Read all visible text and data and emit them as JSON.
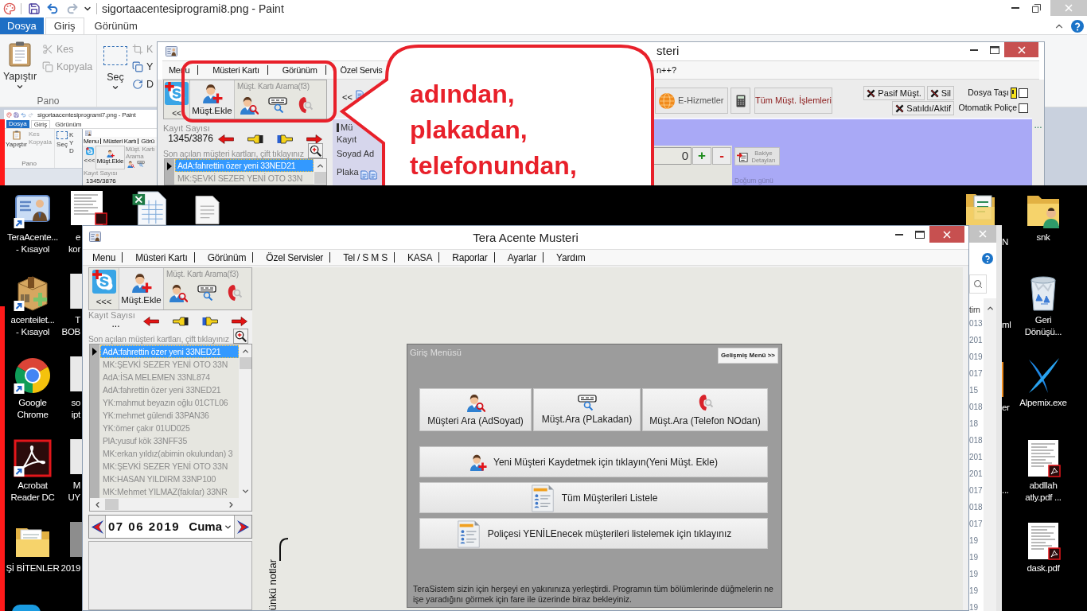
{
  "paint": {
    "title": "sigortaacentesiprogrami8.png - Paint",
    "tabs": [
      {
        "label": "Dosya",
        "kind": "file",
        "selected": false
      },
      {
        "label": "Giriş",
        "kind": "tab",
        "selected": true
      },
      {
        "label": "Görünüm",
        "kind": "tab",
        "selected": false
      }
    ],
    "clipboard": {
      "paste": "Yapıştır",
      "cut": {
        "label": "Kes",
        "disabled": true
      },
      "copy": {
        "label": "Kopyala",
        "disabled": true
      },
      "group": "Pano"
    },
    "image": {
      "select": "Seç",
      "tools": [
        {
          "label": "K",
          "disabled": true
        },
        {
          "label": "Y",
          "disabled": false
        },
        {
          "label": "D",
          "disabled": false
        }
      ]
    },
    "thumbnail": {
      "title": "sigortaacentesiprogrami7.png - Paint",
      "tabs": [
        {
          "label": "Dosya",
          "kind": "file",
          "selected": false
        },
        {
          "label": "Giriş",
          "kind": "tab",
          "selected": true
        },
        {
          "label": "Görünüm",
          "kind": "tab",
          "selected": false
        }
      ],
      "paste": "Yapıştır",
      "cut": "Kes",
      "copy": "Kopyala",
      "group": "Pano",
      "select": "Seç",
      "tools": [
        "K",
        "Y",
        "D"
      ],
      "window": {
        "menu": [
          "Menu",
          "Müsteri Kartı",
          "Görü"
        ],
        "back": "<<<",
        "add_button": "Müşt.Ekle",
        "search_label": "Müşt. Kartı Arama",
        "count_label": "Kayıt Sayısı",
        "count": "1345/3876"
      }
    }
  },
  "front_window": {
    "title": "steri",
    "menu": [
      "Menu",
      "Müsteri Kartı",
      "Görünüm",
      "Özel Servis"
    ],
    "menu_tail": "n++?",
    "back": "<<",
    "add_button": "Müşt.Ekle",
    "search_label": "Müşt. Kartı Arama(f3)",
    "count_label": "Kayıt Sayısı",
    "count": "1345/3876",
    "recent_label": "Son açılan müşteri kartları, çift tıklayınız",
    "recent": [
      {
        "text": "AdA:fahrettin özer yeni 33NED21",
        "selected": true
      },
      {
        "text": "MK:ŞEVKİ SEZER YENİ OTO 33N",
        "selected": false
      }
    ],
    "card_back": "<<",
    "fields": [
      "Mü",
      "Kayıt",
      "Soyad Ad",
      "Plaka"
    ],
    "services": "E-Hizmetler",
    "all_ops": "Tüm Müşt. İşlemleri",
    "flags": [
      "Pasif Müşt.",
      "Sil",
      "Satıldı/Aktif"
    ],
    "options": [
      {
        "label": "Dosya Taşı",
        "checked": false
      },
      {
        "label": "Otomatik Poliçe",
        "checked": false
      }
    ],
    "more": "...",
    "balance": "0",
    "plus": "+",
    "minus": "-",
    "balance_details": "Bakiye Detayları",
    "birthday": "Doğum günü"
  },
  "callout": {
    "text": "adından, plakadan, telefonundan,"
  },
  "desktop": {
    "left_icons": [
      {
        "lines": [
          "TeraAcente...",
          "- Kısayol"
        ],
        "kind": "tera",
        "shortcut": true
      },
      {
        "lines": [
          "acenteilet...",
          "- Kısayol"
        ],
        "kind": "package",
        "shortcut": true
      },
      {
        "lines": [
          "Google",
          "Chrome"
        ],
        "kind": "chrome",
        "shortcut": true
      },
      {
        "lines": [
          "Acrobat",
          "Reader DC"
        ],
        "kind": "acrobat",
        "shortcut": true
      },
      {
        "lines": [
          "Şİ BİTENLER"
        ],
        "kind": "folder",
        "shortcut": false
      }
    ],
    "partial_icons": [
      {
        "lines": [
          "e",
          "kor"
        ],
        "kind": "pdf"
      },
      {
        "lines": [
          "T",
          "BOB"
        ],
        "kind": "doc"
      },
      {
        "lines": [
          "so",
          "ipt"
        ],
        "kind": "doc"
      },
      {
        "lines": [
          "M",
          "UY"
        ],
        "kind": "doc"
      },
      {
        "lines": [
          "2019"
        ],
        "kind": "photo"
      }
    ],
    "hidden_labels": [
      "N",
      "ml",
      "er",
      "..."
    ],
    "explorer": {
      "header": "tirn",
      "cells": [
        "013",
        "201",
        "019",
        "017",
        "15",
        "018",
        "18",
        "018",
        "201",
        "201",
        "017",
        "018",
        "017",
        "19",
        "19",
        "19",
        "19",
        "19"
      ]
    },
    "right_icons": [
      {
        "lines": [
          "snk"
        ],
        "kind": "user-folder"
      },
      {
        "lines": [
          "Geri",
          "Dönüşü..."
        ],
        "kind": "recycle"
      },
      {
        "lines": [
          "Alpemix.exe"
        ],
        "kind": "alpemix"
      },
      {
        "lines": [
          "abdllah",
          "atly.pdf ..."
        ],
        "kind": "pdf"
      },
      {
        "lines": [
          "dask.pdf"
        ],
        "kind": "pdf"
      }
    ]
  },
  "app": {
    "title": "Tera Acente Musteri",
    "menu": [
      "Menu",
      "Müsteri Kartı",
      "Görünüm",
      "Özel Servisler",
      "Tel / S M S",
      "KASA",
      "Raporlar",
      "Ayarlar",
      "Yardım"
    ],
    "back": "<<<",
    "add_button": "Müşt.Ekle",
    "search_label": "Müşt. Kartı Arama(f3)",
    "count_label": "Kayıt Sayısı",
    "count": "...",
    "recent_label": "Son açılan müşteri kartları, çift tıklayınız",
    "recent": [
      {
        "text": "AdA:fahrettin özer yeni 33NED21",
        "selected": true
      },
      {
        "text": "MK:ŞEVKİ SEZER YENİ OTO 33N",
        "selected": false
      },
      {
        "text": "AdA:İSA MELEMEN 33NL874",
        "selected": false
      },
      {
        "text": "AdA:fahrettin özer yeni 33NED21",
        "selected": false
      },
      {
        "text": "YK:mahmut beyazın oğlu 01CTL06",
        "selected": false
      },
      {
        "text": "YK:mehmet gülendi 33PAN36",
        "selected": false
      },
      {
        "text": "YK:ömer çakır 01UD025",
        "selected": false
      },
      {
        "text": "PlA:yusuf kök 33NFF35",
        "selected": false
      },
      {
        "text": "MK:erkan yıldız(abimin okulundan) 3",
        "selected": false
      },
      {
        "text": "MK:ŞEVKİ SEZER YENİ OTO 33N",
        "selected": false
      },
      {
        "text": "MK:HASAN YILDIRM 33NP100",
        "selected": false
      },
      {
        "text": "MK:Mehmet YILMAZ(fakılar) 33NR",
        "selected": false
      }
    ],
    "date": {
      "value": "07 06 2019",
      "day": "Cuma"
    },
    "notes_label": "ünkü notlar",
    "start_menu": {
      "title": "Giriş Menüsü",
      "advanced": "Gelişmiş Menü >>",
      "search_buttons": [
        {
          "label": "Müşteri Ara (AdSoyad)",
          "kind": "name"
        },
        {
          "label": "Müşt.Ara (PLakadan)",
          "kind": "plate"
        },
        {
          "label": "Müşt.Ara (Telefon NOdan)",
          "kind": "phone"
        }
      ],
      "actions": [
        {
          "label": "Yeni Müşteri Kaydetmek için tıklayın(Yeni Müşt. Ekle)",
          "kind": "add"
        },
        {
          "label": "Tüm Müşterileri Listele",
          "kind": "list"
        },
        {
          "label": "Poliçesi YENİLEnecek müşterileri listelemek için tıklayınız",
          "kind": "list"
        }
      ],
      "footer": "TeraSistem sizin için herşeyi en yakınınıza yerleştirdi. Programın tüm bölümlerinde düğmelerin ne işe yaradığını görmek için fare ile üzerinde biraz bekleyiniz."
    }
  }
}
